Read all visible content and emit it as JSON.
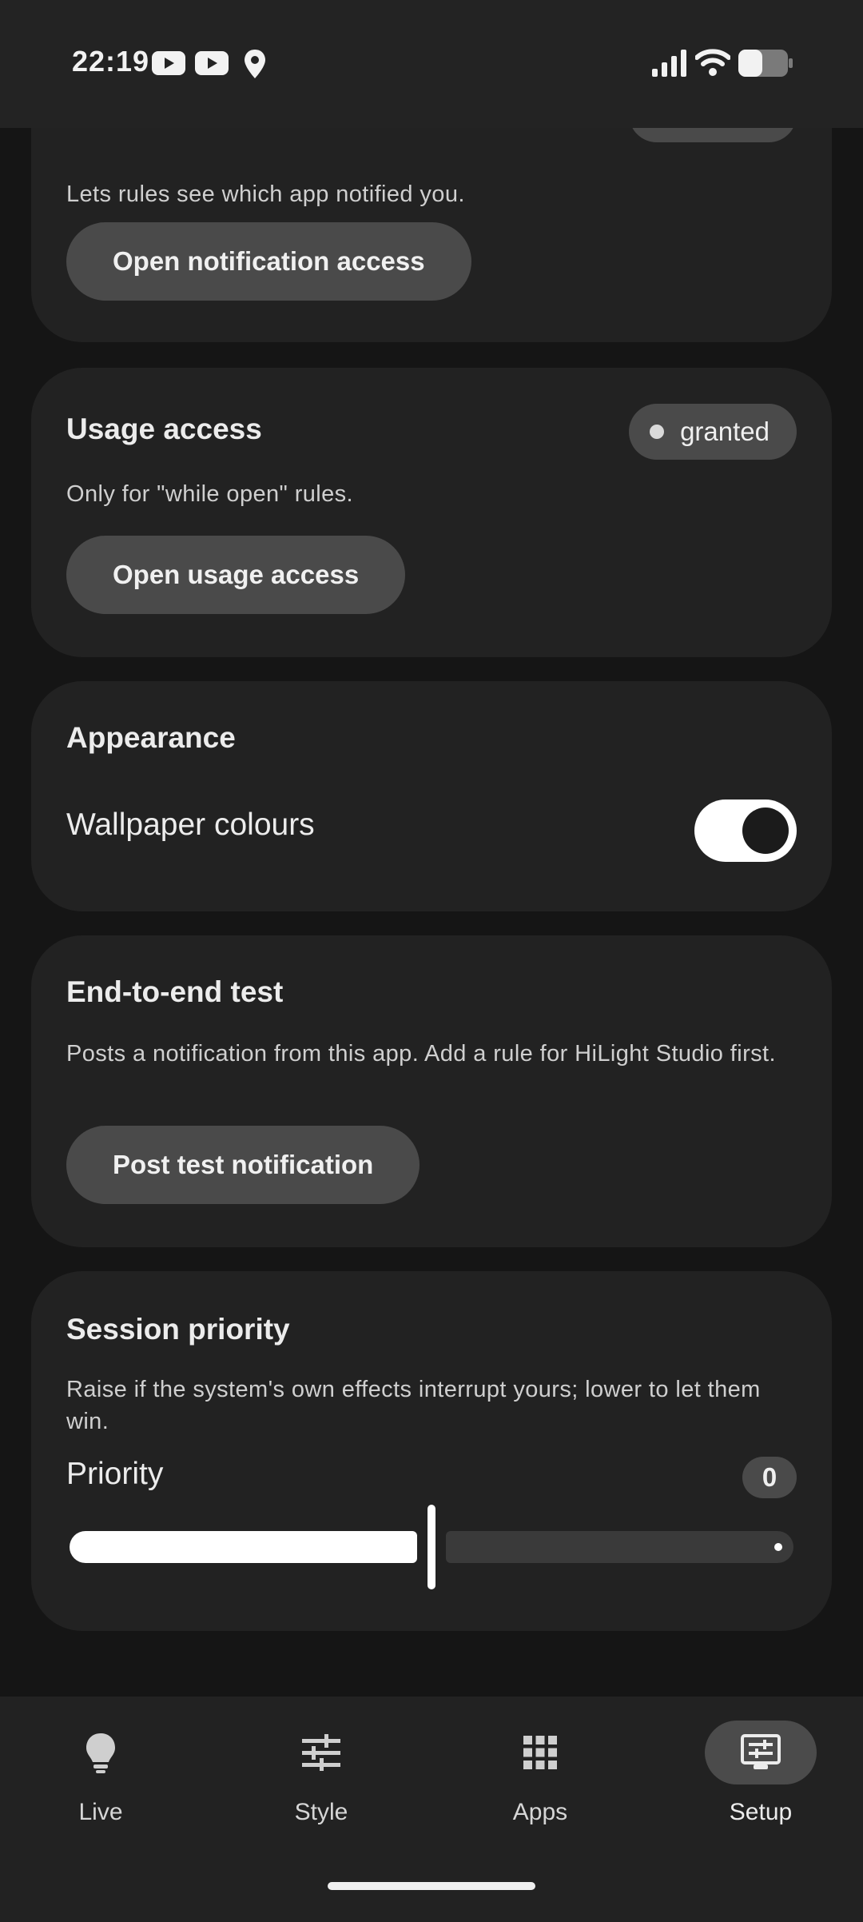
{
  "status_bar": {
    "time": "22:19",
    "icons": [
      "youtube-icon",
      "youtube-icon",
      "location-icon",
      "signal-icon",
      "wifi-icon",
      "battery-icon"
    ]
  },
  "notification_card": {
    "description": "Lets rules see which app notified you.",
    "button_label": "Open notification access"
  },
  "usage_card": {
    "title": "Usage access",
    "badge": "granted",
    "description": "Only for \"while open\" rules.",
    "button_label": "Open usage access"
  },
  "appearance_card": {
    "title": "Appearance",
    "toggle_label": "Wallpaper colours",
    "toggle_on": true
  },
  "test_card": {
    "title": "End-to-end test",
    "description": "Posts a notification from this app. Add a rule for HiLight Studio first.",
    "button_label": "Post test notification"
  },
  "priority_card": {
    "title": "Session priority",
    "description": "Raise if the system's own effects interrupt yours; lower to let them win.",
    "slider_label": "Priority",
    "slider_value": "0",
    "slider_fraction": 0.5
  },
  "bottom_nav": {
    "items": [
      {
        "label": "Live",
        "icon": "lightbulb-icon"
      },
      {
        "label": "Style",
        "icon": "sliders-icon"
      },
      {
        "label": "Apps",
        "icon": "grid-icon"
      },
      {
        "label": "Setup",
        "icon": "setup-icon"
      }
    ],
    "active": "Setup"
  },
  "colors": {
    "background": "#151515",
    "card": "#222222",
    "button": "#4a4a4a",
    "accent": "#ffffff"
  }
}
